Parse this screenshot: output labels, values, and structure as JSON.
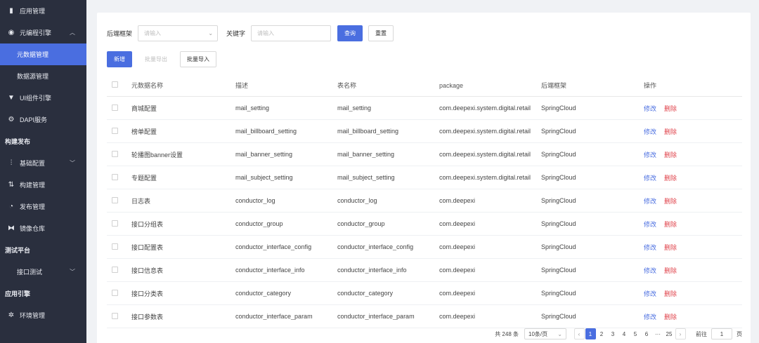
{
  "sidebar": {
    "items": [
      {
        "label": "应用管理",
        "icon": "grid-icon",
        "type": "item"
      },
      {
        "label": "元编程引擎",
        "icon": "cube-icon",
        "type": "item",
        "expanded": true
      },
      {
        "label": "元数据管理",
        "type": "sub",
        "active": true
      },
      {
        "label": "数据源管理",
        "type": "sub"
      },
      {
        "label": "UI组件引擎",
        "icon": "component-icon",
        "type": "item"
      },
      {
        "label": "DAPI服务",
        "icon": "gear-icon",
        "type": "item"
      },
      {
        "label": "构建发布",
        "type": "group"
      },
      {
        "label": "基础配置",
        "icon": "sliders-icon",
        "type": "item",
        "collapsed": true
      },
      {
        "label": "构建管理",
        "icon": "build-icon",
        "type": "item"
      },
      {
        "label": "发布管理",
        "icon": "publish-icon",
        "type": "item"
      },
      {
        "label": "镜像仓库",
        "icon": "mirror-icon",
        "type": "item"
      },
      {
        "label": "测试平台",
        "type": "group"
      },
      {
        "label": "接口测试",
        "type": "sub",
        "collapsed": true
      },
      {
        "label": "应用引擎",
        "type": "group"
      },
      {
        "label": "环境管理",
        "icon": "settings-icon",
        "type": "item"
      }
    ]
  },
  "filters": {
    "framework_label": "后端框架",
    "framework_placeholder": "请输入",
    "keyword_label": "关键字",
    "keyword_placeholder": "请输入",
    "query_label": "查询",
    "reset_label": "重置"
  },
  "actions": {
    "add_label": "新增",
    "batch_export_label": "批量导出",
    "batch_import_label": "批量导入"
  },
  "table": {
    "headers": [
      "元数据名称",
      "描述",
      "表名称",
      "package",
      "后端框架",
      "操作"
    ],
    "edit_label": "修改",
    "delete_label": "删除",
    "rows": [
      [
        "商城配置",
        "mail_setting",
        "mail_setting",
        "com.deepexi.system.digital.retail",
        "SpringCloud"
      ],
      [
        "榜单配置",
        "mail_billboard_setting",
        "mail_billboard_setting",
        "com.deepexi.system.digital.retail",
        "SpringCloud"
      ],
      [
        "轮播图banner设置",
        "mail_banner_setting",
        "mail_banner_setting",
        "com.deepexi.system.digital.retail",
        "SpringCloud"
      ],
      [
        "专题配置",
        "mail_subject_setting",
        "mail_subject_setting",
        "com.deepexi.system.digital.retail",
        "SpringCloud"
      ],
      [
        "日志表",
        "conductor_log",
        "conductor_log",
        "com.deepexi",
        "SpringCloud"
      ],
      [
        "接口分组表",
        "conductor_group",
        "conductor_group",
        "com.deepexi",
        "SpringCloud"
      ],
      [
        "接口配置表",
        "conductor_interface_config",
        "conductor_interface_config",
        "com.deepexi",
        "SpringCloud"
      ],
      [
        "接口信息表",
        "conductor_interface_info",
        "conductor_interface_info",
        "com.deepexi",
        "SpringCloud"
      ],
      [
        "接口分类表",
        "conductor_category",
        "conductor_category",
        "com.deepexi",
        "SpringCloud"
      ],
      [
        "接口参数表",
        "conductor_interface_param",
        "conductor_interface_param",
        "com.deepexi",
        "SpringCloud"
      ]
    ]
  },
  "pager": {
    "total": "共 248 条",
    "page_size": "10条/页",
    "pages": [
      "1",
      "2",
      "3",
      "4",
      "5",
      "6",
      "···",
      "25"
    ],
    "current": "1",
    "goto_label": "前往",
    "goto_value": "1",
    "page_suffix": "页"
  },
  "colors": {
    "accent": "#4a6ee0",
    "sidebar_bg": "#2a2f3e",
    "danger": "#e0434b"
  }
}
